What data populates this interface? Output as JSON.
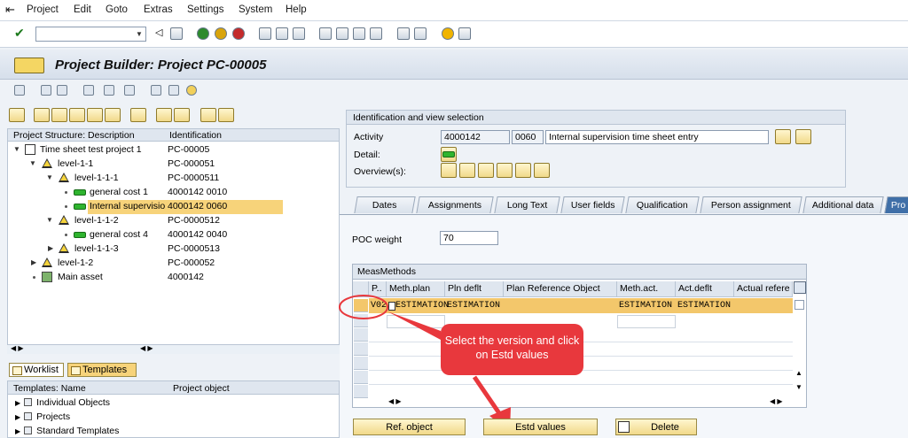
{
  "menu": {
    "items": [
      "Project",
      "Edit",
      "Goto",
      "Extras",
      "Settings",
      "System",
      "Help"
    ]
  },
  "title": "Project Builder: Project PC-00005",
  "tree": {
    "col_desc": "Project Structure: Description",
    "col_id": "Identification",
    "rows": [
      {
        "label": "Time sheet test project 1",
        "id": "PC-00005"
      },
      {
        "label": "level-1-1",
        "id": "PC-000051"
      },
      {
        "label": "level-1-1-1",
        "id": "PC-0000511"
      },
      {
        "label": "general cost 1",
        "id": "4000142 0010"
      },
      {
        "label": "Internal supervisio",
        "id": "4000142 0060"
      },
      {
        "label": "level-1-1-2",
        "id": "PC-0000512"
      },
      {
        "label": "general cost 4",
        "id": "4000142 0040"
      },
      {
        "label": "level-1-1-3",
        "id": "PC-0000513"
      },
      {
        "label": "level-1-2",
        "id": "PC-000052"
      },
      {
        "label": "Main asset",
        "id": "4000142"
      }
    ]
  },
  "worklist": {
    "worklist_label": "Worklist",
    "templates_label": "Templates"
  },
  "templates": {
    "col_name": "Templates: Name",
    "col_obj": "Project object",
    "rows": [
      "Individual Objects",
      "Projects",
      "Standard Templates"
    ]
  },
  "idview": {
    "header": "Identification and view selection",
    "activity_label": "Activity",
    "activity_network": "4000142",
    "activity_op": "0060",
    "activity_desc": "Internal supervision time sheet entry",
    "detail_label": "Detail:",
    "overview_label": "Overview(s):"
  },
  "tabs": [
    "Dates",
    "Assignments",
    "Long Text",
    "User fields",
    "Qualification",
    "Person assignment",
    "Additional data",
    "Pro"
  ],
  "poc": {
    "label": "POC weight",
    "value": "70"
  },
  "meas": {
    "caption": "MeasMethods",
    "headers": [
      "P..",
      "Meth.plan",
      "Pln deflt",
      "Plan Reference Object",
      "Meth.act.",
      "Act.deflt",
      "Actual refere"
    ],
    "row": {
      "version": "V02",
      "meth_plan": "ESTIMATION",
      "pln_deflt": "ESTIMATION",
      "meth_act": "ESTIMATION",
      "act_deflt": "ESTIMATION"
    }
  },
  "annotation": {
    "text": "Select the version and click on Estd values"
  },
  "buttons": {
    "ref_object": "Ref. object",
    "estd_values": "Estd values",
    "delete": "Delete"
  },
  "colors": {
    "selected_row": "#f3c76b",
    "annotation": "#e8383d",
    "tree_selection": "#f7d37a"
  }
}
